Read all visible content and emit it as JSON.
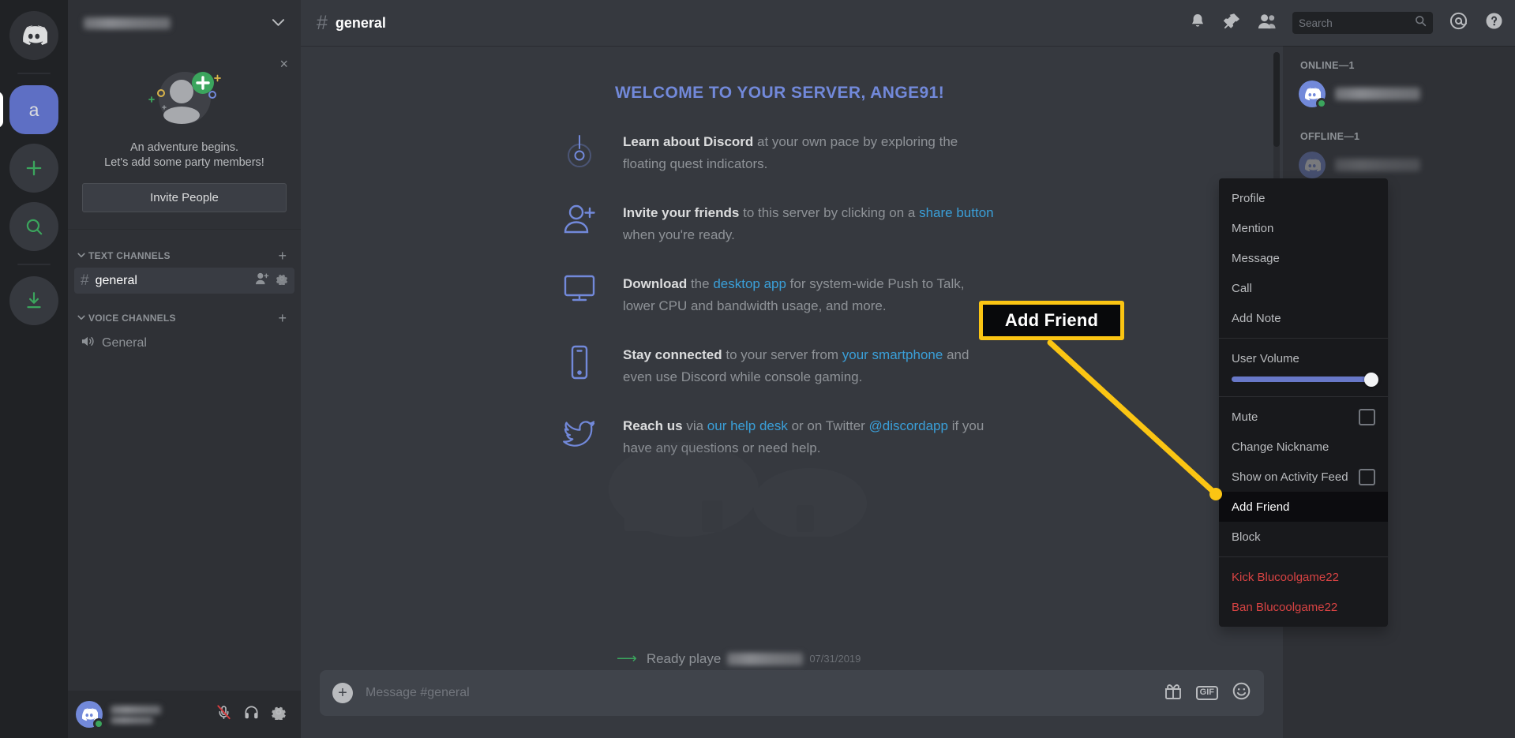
{
  "app": {
    "name": "Discord"
  },
  "rail": {
    "items": [
      {
        "name": "discord-home",
        "label": "",
        "icon": "discord-logo-icon"
      },
      {
        "name": "server-a",
        "label": "a",
        "icon": "server-avatar-icon",
        "active": true
      },
      {
        "name": "add-server",
        "label": "",
        "icon": "plus-icon"
      },
      {
        "name": "explore-servers",
        "label": "",
        "icon": "compass-search-icon"
      },
      {
        "name": "download-apps",
        "label": "",
        "icon": "download-icon"
      }
    ]
  },
  "sidebar": {
    "server_name": "",
    "invite_card": {
      "line1": "An adventure begins.",
      "line2": "Let's add some party members!",
      "button_label": "Invite People",
      "close_label": "×"
    },
    "categories": [
      {
        "label": "TEXT CHANNELS",
        "add_label": "+",
        "channels": [
          {
            "name": "general",
            "prefix": "#",
            "active": true,
            "actions": [
              "invite-member-icon",
              "channel-settings-icon"
            ]
          }
        ]
      },
      {
        "label": "VOICE CHANNELS",
        "add_label": "+",
        "channels": [
          {
            "name": "General",
            "prefix": "🔊",
            "active": false,
            "actions": []
          }
        ]
      }
    ],
    "user_panel": {
      "username": "",
      "discriminator": "",
      "icons": [
        "microphone-muted-icon",
        "headphones-icon",
        "user-settings-gear-icon"
      ]
    }
  },
  "topbar": {
    "channel_prefix": "#",
    "channel_name": "general",
    "icons": [
      "notification-bell-icon",
      "pinned-messages-icon",
      "member-list-icon",
      "mentions-icon",
      "help-icon"
    ],
    "search": {
      "placeholder": "Search",
      "value": ""
    }
  },
  "welcome": {
    "title": "WELCOME TO YOUR SERVER, ANGE91!",
    "rows": [
      {
        "icon": "quest-indicator-icon",
        "bold": "Learn about Discord",
        "rest": " at your own pace by exploring the floating quest indicators."
      },
      {
        "icon": "add-person-icon",
        "bold": "Invite your friends",
        "rest": " to this server by clicking on a ",
        "link": "share button",
        "tail": " when you're ready."
      },
      {
        "icon": "desktop-monitor-icon",
        "bold": "Download",
        "rest": " the ",
        "link": "desktop app",
        "tail": " for system-wide Push to Talk, lower CPU and bandwidth usage, and more."
      },
      {
        "icon": "smartphone-icon",
        "bold": "Stay connected",
        "rest": " to your server from ",
        "link": "your smartphone",
        "tail": " and even use Discord while console gaming."
      },
      {
        "icon": "twitter-bird-icon",
        "bold": "Reach us",
        "rest": " via ",
        "link": "our help desk",
        "tail": " or on Twitter ",
        "link2": "@discordapp",
        "tail2": " if you have any questions or need help."
      }
    ]
  },
  "message": {
    "system_text": "Ready playe",
    "timestamp": "07/31/2019"
  },
  "composer": {
    "placeholder": "Message #general",
    "plus_label": "+",
    "icons": [
      "gift-icon",
      "gif-icon",
      "emoji-icon"
    ],
    "gif_label": "GIF"
  },
  "members": {
    "sections": [
      {
        "header": "ONLINE—1",
        "count": 1,
        "users": [
          {
            "name": "",
            "status": "online"
          }
        ]
      },
      {
        "header": "OFFLINE—1",
        "count": 1,
        "users": [
          {
            "name": "",
            "status": "offline"
          }
        ]
      }
    ]
  },
  "context_menu": {
    "items": [
      {
        "label": "Profile",
        "type": "item"
      },
      {
        "label": "Mention",
        "type": "item"
      },
      {
        "label": "Message",
        "type": "item"
      },
      {
        "label": "Call",
        "type": "item"
      },
      {
        "label": "Add Note",
        "type": "item"
      },
      {
        "type": "separator"
      },
      {
        "label": "User Volume",
        "type": "item"
      },
      {
        "type": "slider",
        "value": 100
      },
      {
        "type": "separator"
      },
      {
        "label": "Mute",
        "type": "checkbox",
        "checked": false
      },
      {
        "label": "Change Nickname",
        "type": "item"
      },
      {
        "label": "Show on Activity Feed",
        "type": "checkbox",
        "checked": false
      },
      {
        "label": "Add Friend",
        "type": "item",
        "hovered": true
      },
      {
        "label": "Block",
        "type": "item"
      },
      {
        "type": "separator"
      },
      {
        "label": "Kick Blucoolgame22",
        "type": "item",
        "danger": true
      },
      {
        "label": "Ban Blucoolgame22",
        "type": "item",
        "danger": true
      }
    ]
  },
  "annotation": {
    "callout_label": "Add Friend",
    "accent_color": "#fbc513"
  }
}
